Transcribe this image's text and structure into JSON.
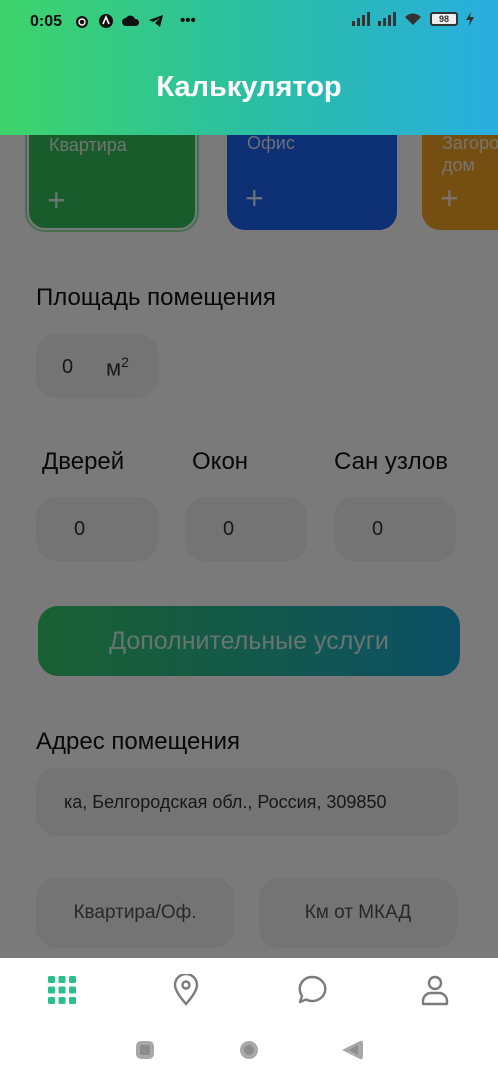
{
  "status_bar": {
    "time": "0:05",
    "battery": "98"
  },
  "header": {
    "title": "Калькулятор"
  },
  "property_types": [
    {
      "label": "Квартира",
      "color": "#35c05c",
      "selected": true
    },
    {
      "label": "Офис",
      "color": "#1d63f0",
      "selected": false
    },
    {
      "label": "Загородный\nдом",
      "color": "#f4a324",
      "selected": false
    }
  ],
  "area": {
    "title": "Площадь помещения",
    "value": "0",
    "unit": "м",
    "unit_power": "2"
  },
  "counters": {
    "doors_label": "Дверей",
    "doors_value": "0",
    "windows_label": "Окон",
    "windows_value": "0",
    "bathrooms_label": "Сан узлов",
    "bathrooms_value": "0"
  },
  "extra_services": {
    "label": "Дополнительные услуги"
  },
  "address": {
    "title": "Адрес помещения",
    "value": "ка, Белгородская обл., Россия, 309850",
    "apartment_placeholder": "Квартира/Оф.",
    "distance_placeholder": "Км от МКАД"
  },
  "nav": {
    "active_color": "#2bbf8a",
    "inactive_color": "#7a7a80"
  }
}
